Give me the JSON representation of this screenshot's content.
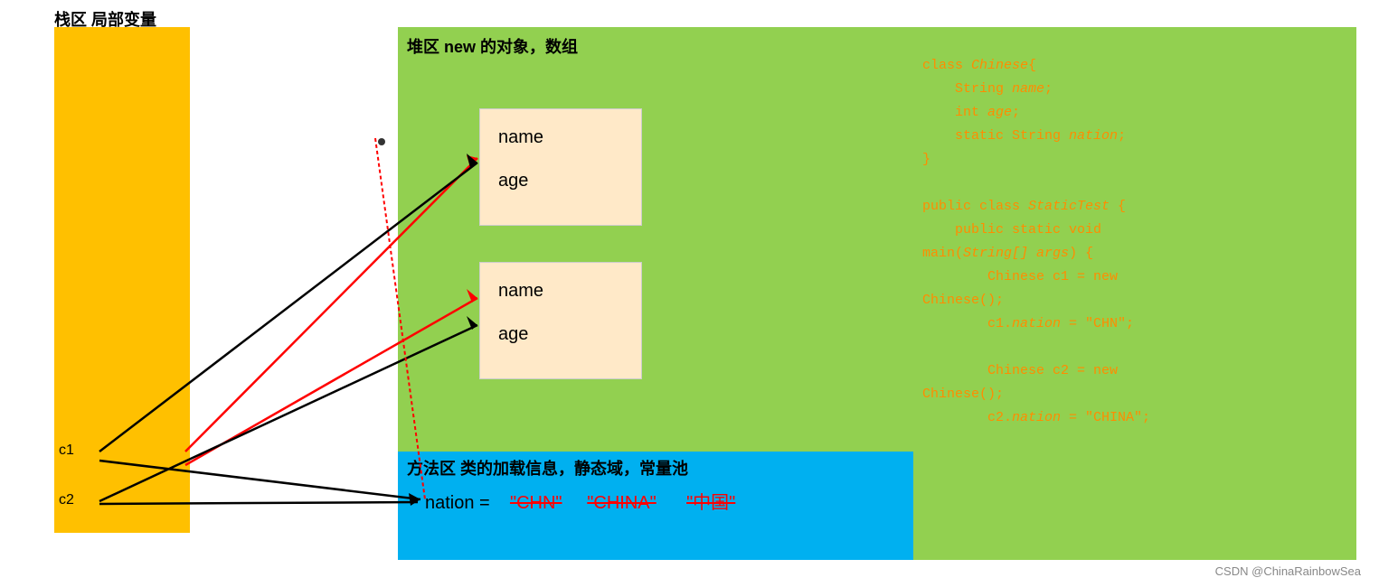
{
  "labels": {
    "stack_title": "栈区 局部变量",
    "heap_title": "堆区  new 的对象，数组",
    "method_title": "方法区 类的加载信息，静态域，常量池",
    "c1": "c1",
    "c2": "c2",
    "obj1_field1": "name",
    "obj1_field2": "age",
    "obj2_field1": "name",
    "obj2_field2": "age",
    "nation_label": "nation =",
    "nation_val1": "\"CHN\"",
    "nation_val2": "\"CHINA\"",
    "nation_val3": "\"中国\"",
    "watermark": "CSDN @ChinaRainbowSea"
  },
  "code": {
    "line1": "class Chinese{",
    "line2": "    String name;",
    "line3": "    int age;",
    "line4": "    static String nation;",
    "line5": "}",
    "line6": "",
    "line7": "public class StaticTest {",
    "line8": "    public static void",
    "line9": "main(String[] args) {",
    "line10": "        Chinese c1 = new",
    "line11": "Chinese();",
    "line12": "        c1.nation = \"CHN\";",
    "line13": "",
    "line14": "        Chinese c2 = new",
    "line15": "Chinese();",
    "line16": "        c2.nation = \"CHINA\";"
  }
}
